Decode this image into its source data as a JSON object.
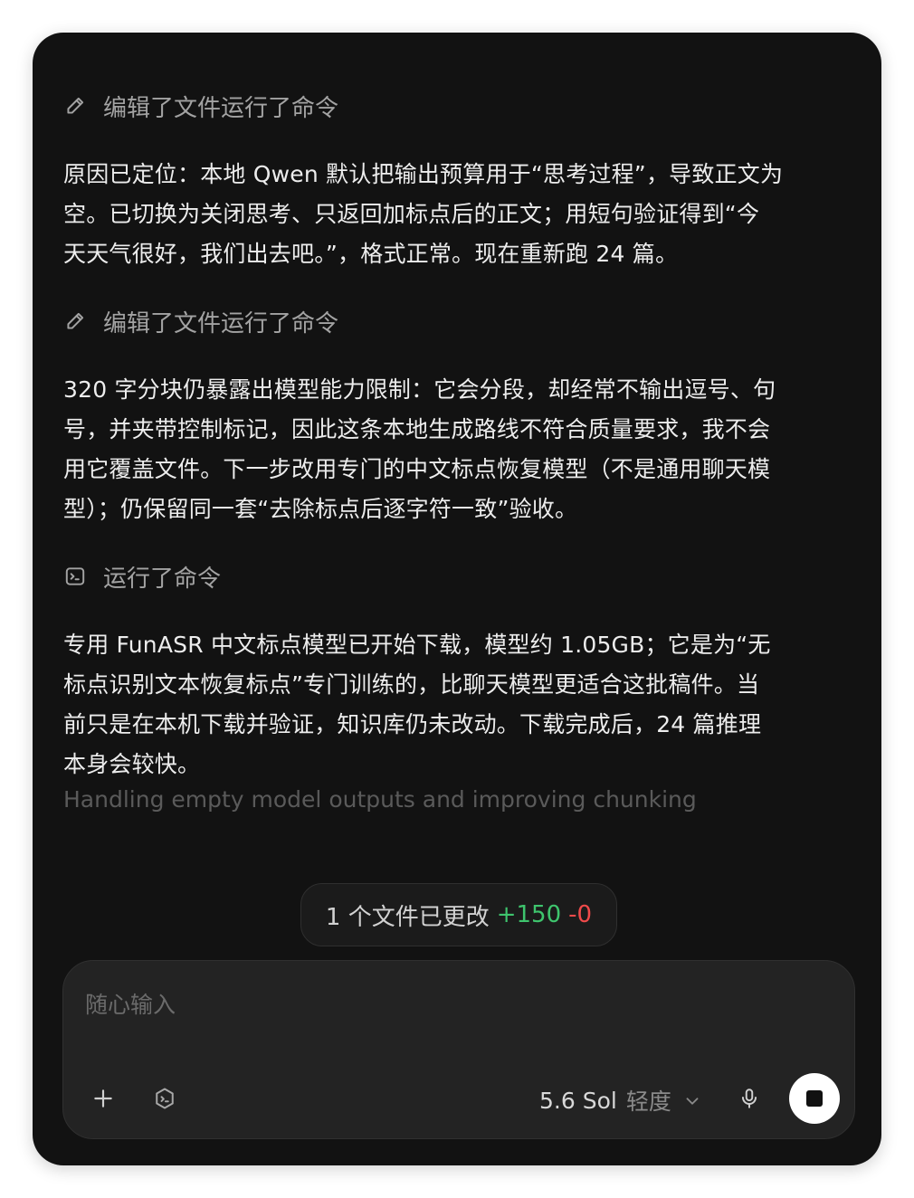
{
  "transcript": {
    "actions": [
      {
        "icon": "pencil-icon",
        "label": "编辑了文件运行了命令"
      },
      {
        "icon": "pencil-icon",
        "label": "编辑了文件运行了命令"
      },
      {
        "icon": "terminal-icon",
        "label": "运行了命令"
      }
    ],
    "paragraphs": [
      {
        "lines": [
          "原因已定位：本地 Qwen 默认把输出预算用于“思考过程”，导致正文为",
          "空。已切换为关闭思考、只返回加标点后的正文；用短句验证得到“今",
          "天天气很好，我们出去吧。”，格式正常。现在重新跑 24 篇。"
        ]
      },
      {
        "lines": [
          "320 字分块仍暴露出模型能力限制：它会分段，却经常不输出逗号、句",
          "号，并夹带控制标记，因此这条本地生成路线不符合质量要求，我不会",
          "用它覆盖文件。下一步改用专门的中文标点恢复模型（不是通用聊天模",
          "型）；仍保留同一套“去除标点后逐字符一致”验收。"
        ]
      },
      {
        "lines": [
          "专用 FunASR 中文标点模型已开始下载，模型约 1.05GB；它是为“无",
          "标点识别文本恢复标点”专门训练的，比聊天模型更适合这批稿件。当",
          "前只是在本机下载并验证，知识库仍未改动。下载完成后，24 篇推理",
          "本身会较快。"
        ]
      }
    ],
    "status": "Handling empty model outputs and improving chunking"
  },
  "changes": {
    "label": "1 个文件已更改",
    "added": "+150",
    "removed": "-0"
  },
  "composer": {
    "placeholder": "随心输入",
    "model": "5.6 Sol",
    "effort": "轻度",
    "icons": [
      "plus-icon",
      "shield-icon",
      "chevron-down-icon",
      "microphone-icon",
      "stop-icon"
    ]
  },
  "colors": {
    "background": "#121212",
    "added": "#3ec46d",
    "removed": "#ef4a4a"
  }
}
